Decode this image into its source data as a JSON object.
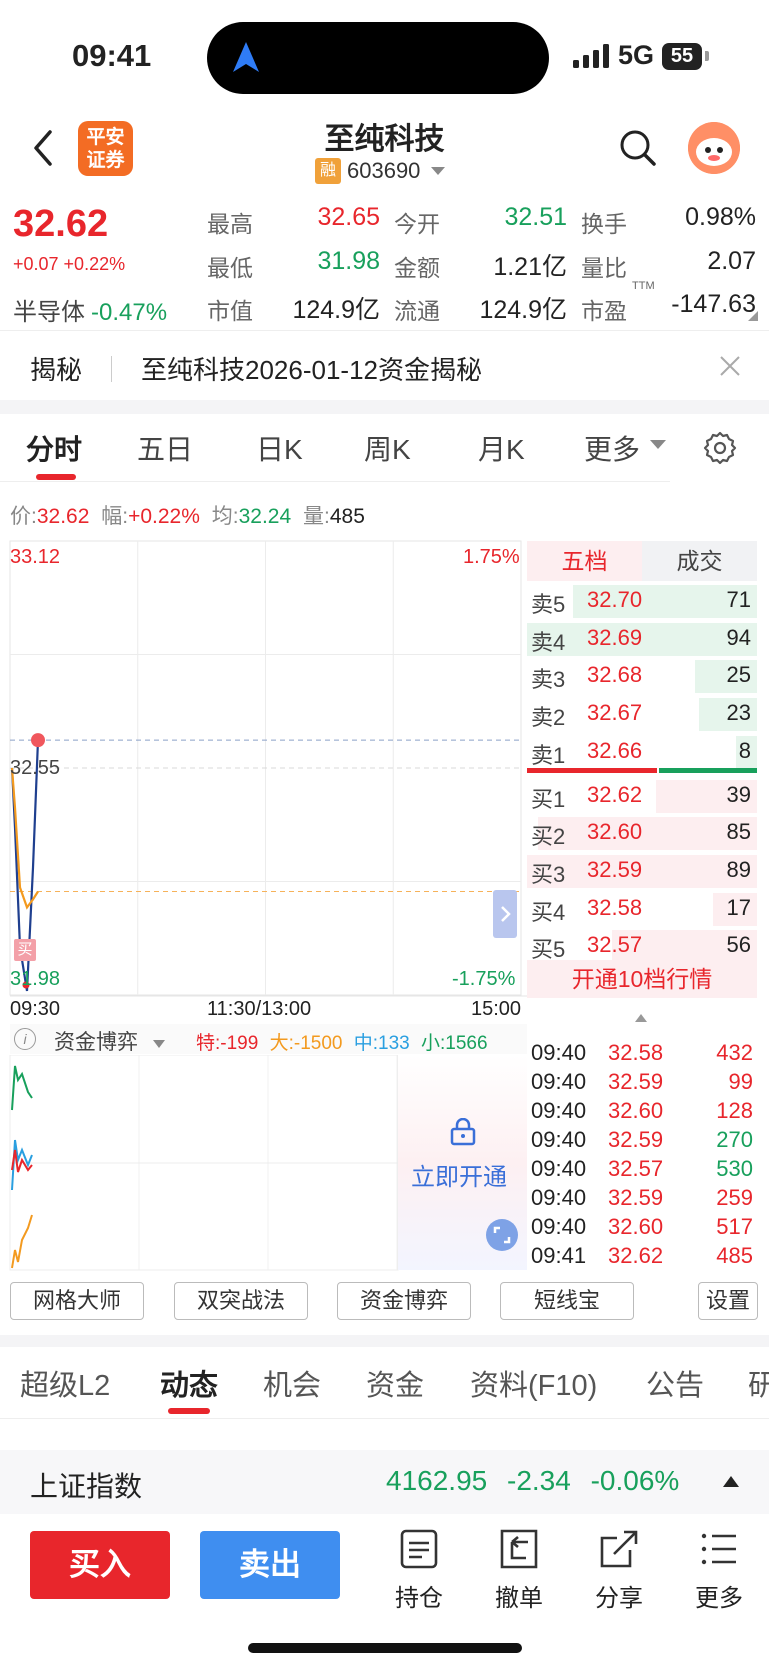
{
  "status_bar": {
    "time": "09:41",
    "network": "5G",
    "battery": "55"
  },
  "header": {
    "logo_line1": "平安",
    "logo_line2": "证券",
    "title": "至纯科技",
    "margin_badge": "融",
    "code": "603690"
  },
  "quote": {
    "price": "32.62",
    "change": "+0.07  +0.22%",
    "sector_name": "半导体",
    "sector_change": "-0.47%",
    "fields": [
      {
        "label": "最高",
        "value": "32.65",
        "color": "#e8262c"
      },
      {
        "label": "今开",
        "value": "32.51",
        "color": "#18a05c"
      },
      {
        "label": "换手",
        "value": "0.98%",
        "color": "#222222"
      },
      {
        "label": "最低",
        "value": "31.98",
        "color": "#18a05c"
      },
      {
        "label": "金额",
        "value": "1.21亿",
        "color": "#222222"
      },
      {
        "label": "量比",
        "value": "2.07",
        "color": "#222222"
      },
      {
        "label": "市值",
        "value": "124.9亿",
        "color": "#222222"
      },
      {
        "label": "流通",
        "value": "124.9亿",
        "color": "#222222"
      },
      {
        "label": "市盈",
        "value": "-147.63",
        "color": "#222222"
      }
    ],
    "pe_suffix": "TTM"
  },
  "banner": {
    "tag": "揭秘",
    "text": "至纯科技2026-01-12资金揭秘"
  },
  "chart_tabs": [
    "分时",
    "五日",
    "日K",
    "周K",
    "月K",
    "更多"
  ],
  "info_line": {
    "price_label": "价:",
    "price": "32.62",
    "change_label": "幅:",
    "change": "+0.22%",
    "avg_label": "均:",
    "avg": "32.24",
    "vol_label": "量:",
    "vol": "485"
  },
  "chart_data": {
    "type": "line",
    "y_top_label": "33.12",
    "y_top_pct": "1.75%",
    "y_mid_label": "32.55",
    "y_bottom_label": "31.98",
    "y_bottom_pct": "-1.75%",
    "x_labels": [
      "09:30",
      "11:30/13:00",
      "15:00"
    ],
    "ylim": [
      31.98,
      33.12
    ],
    "series": [
      {
        "values": [
          32.55,
          32.4,
          32.1,
          31.99,
          32.3,
          32.62
        ],
        "color": "#1f3f8f"
      },
      {
        "values": [
          32.55,
          32.45,
          32.25,
          32.2,
          32.22,
          32.24
        ],
        "color": "#f39a1f"
      }
    ],
    "prev_close": 32.55,
    "avg_line": 32.24,
    "last_price": 32.62,
    "buy_marker": "买"
  },
  "orderbook": {
    "tab_active": "五档",
    "tab_other": "成交",
    "asks": [
      {
        "label": "卖5",
        "price": "32.70",
        "vol": "71",
        "bar": 0.8
      },
      {
        "label": "卖4",
        "price": "32.69",
        "vol": "94",
        "bar": 1.0
      },
      {
        "label": "卖3",
        "price": "32.68",
        "vol": "25",
        "bar": 0.27
      },
      {
        "label": "卖2",
        "price": "32.67",
        "vol": "23",
        "bar": 0.25
      },
      {
        "label": "卖1",
        "price": "32.66",
        "vol": "8",
        "bar": 0.09
      }
    ],
    "bids": [
      {
        "label": "买1",
        "price": "32.62",
        "vol": "39",
        "bar": 0.44
      },
      {
        "label": "买2",
        "price": "32.60",
        "vol": "85",
        "bar": 0.95
      },
      {
        "label": "买3",
        "price": "32.59",
        "vol": "89",
        "bar": 1.0
      },
      {
        "label": "买4",
        "price": "32.58",
        "vol": "17",
        "bar": 0.19
      },
      {
        "label": "买5",
        "price": "32.57",
        "vol": "56",
        "bar": 0.63
      }
    ],
    "open_more": "开通10档行情"
  },
  "ticks": [
    {
      "time": "09:40",
      "price": "32.58",
      "vol": "432",
      "color": "#e8262c"
    },
    {
      "time": "09:40",
      "price": "32.59",
      "vol": "99",
      "color": "#e8262c"
    },
    {
      "time": "09:40",
      "price": "32.60",
      "vol": "128",
      "color": "#e8262c"
    },
    {
      "time": "09:40",
      "price": "32.59",
      "vol": "270",
      "color": "#18a05c"
    },
    {
      "time": "09:40",
      "price": "32.57",
      "vol": "530",
      "color": "#18a05c"
    },
    {
      "time": "09:40",
      "price": "32.59",
      "vol": "259",
      "color": "#e8262c"
    },
    {
      "time": "09:40",
      "price": "32.60",
      "vol": "517",
      "color": "#e8262c"
    },
    {
      "time": "09:41",
      "price": "32.62",
      "vol": "485",
      "color": "#e8262c"
    }
  ],
  "capital_game": {
    "title": "资金博弈",
    "special": "特:-199",
    "large": "大:-1500",
    "medium": "中:133",
    "small": "小:1566",
    "unlock": "立即开通"
  },
  "tools": [
    "网格大师",
    "双突战法",
    "资金博弈",
    "短线宝",
    "设置"
  ],
  "bottom_tabs": [
    "超级L2",
    "动态",
    "机会",
    "资金",
    "资料(F10)",
    "公告",
    "研"
  ],
  "index": {
    "name": "上证指数",
    "value": "4162.95",
    "change": "-2.34",
    "pct": "-0.06%"
  },
  "actions": {
    "buy": "买入",
    "sell": "卖出",
    "hold": "持仓",
    "cancel": "撤单",
    "share": "分享",
    "more": "更多"
  }
}
